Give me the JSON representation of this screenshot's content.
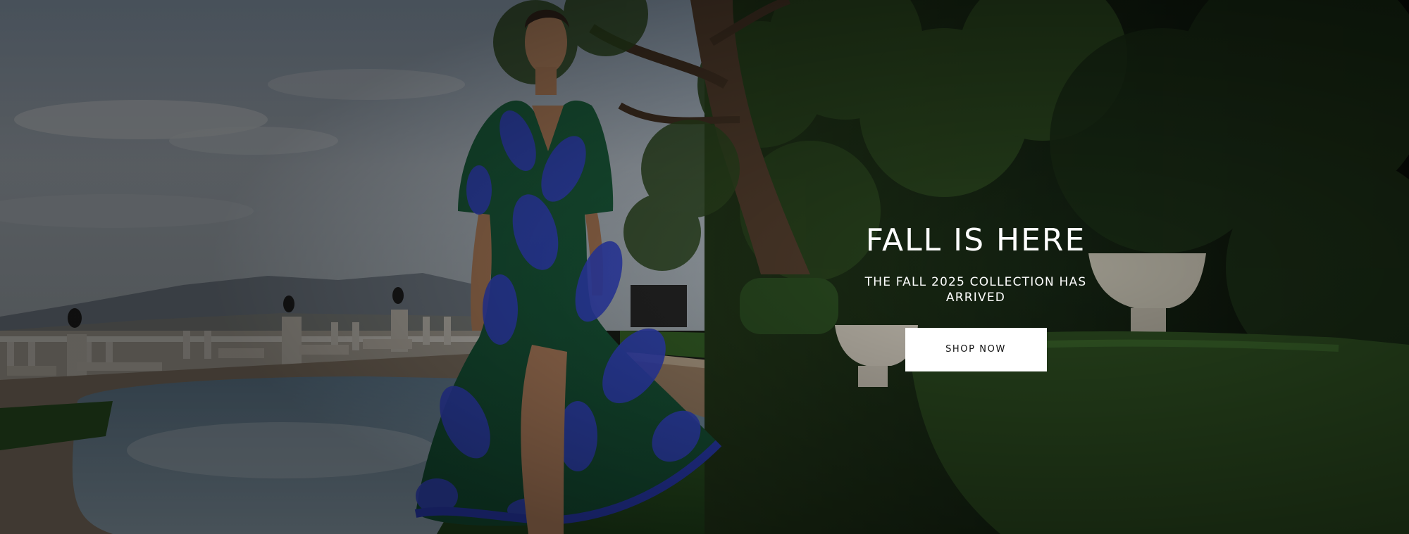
{
  "hero": {
    "headline": "FALL IS HERE",
    "subheadline": "THE FALL 2025 COLLECTION HAS ARRIVED",
    "cta_label": "SHOP NOW"
  },
  "colors": {
    "text": "#ffffff",
    "button_bg": "#ffffff",
    "button_text": "#111111",
    "dress_green": "#1f6a44",
    "dress_blue": "#3b4fe0"
  },
  "image": {
    "subject": "model-in-floral-wrap-dress",
    "setting": "garden-pool-terrace"
  }
}
